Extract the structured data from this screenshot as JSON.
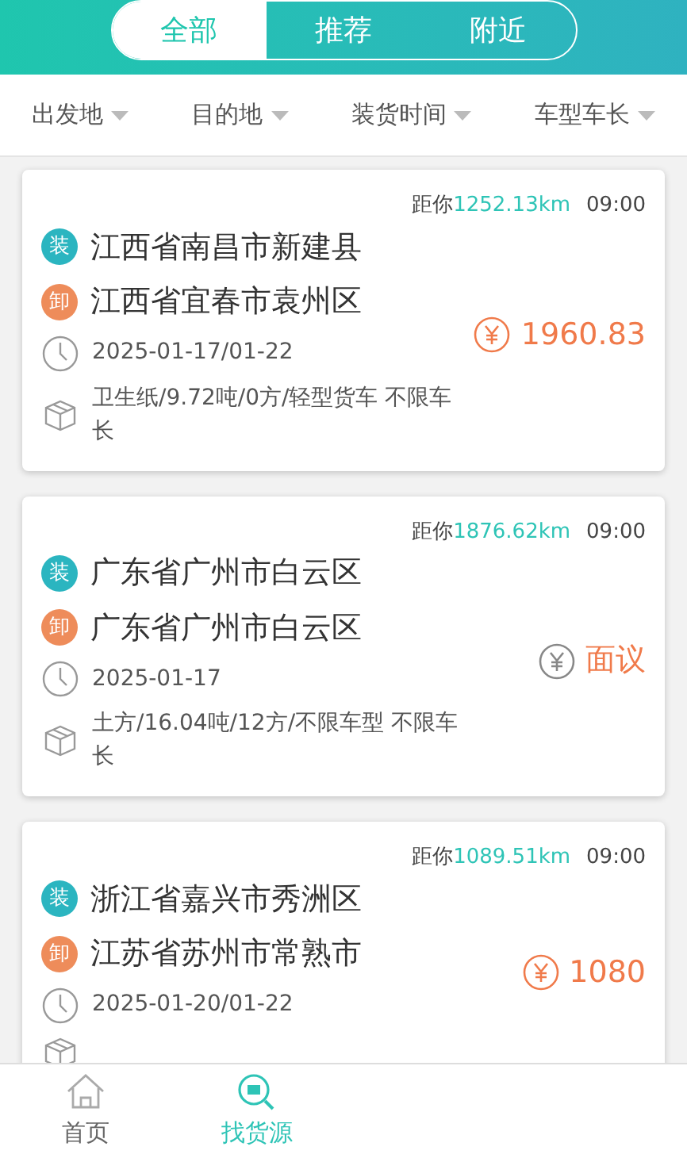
{
  "tabs": [
    {
      "label": "全部",
      "selected": true
    },
    {
      "label": "推荐",
      "selected": false
    },
    {
      "label": "附近",
      "selected": false
    }
  ],
  "filters": [
    "出发地",
    "目的地",
    "装货时间",
    "车型车长"
  ],
  "orders": [
    {
      "distance_prefix": "距你",
      "distance": "1252.13km",
      "time": "09:00",
      "load_badge": "装",
      "load": "江西省南昌市新建县",
      "unload_badge": "卸",
      "unload": "江西省宜春市袁州区",
      "date": "2025-01-17/01-22",
      "cargo": "卫生纸/9.72吨/0方/轻型货车 不限车长",
      "price": {
        "kind": "amount",
        "text": "1960.83"
      }
    },
    {
      "distance_prefix": "距你",
      "distance": "1876.62km",
      "time": "09:00",
      "load_badge": "装",
      "load": "广东省广州市白云区",
      "unload_badge": "卸",
      "unload": "广东省广州市白云区",
      "date": "2025-01-17",
      "cargo": "土方/16.04吨/12方/不限车型 不限车长",
      "price": {
        "kind": "negotiable",
        "text": "面议"
      }
    },
    {
      "distance_prefix": "距你",
      "distance": "1089.51km",
      "time": "09:00",
      "load_badge": "装",
      "load": "浙江省嘉兴市秀洲区",
      "unload_badge": "卸",
      "unload": "江苏省苏州市常熟市",
      "date": "2025-01-20/01-22",
      "price": {
        "kind": "amount",
        "text": "1080"
      }
    }
  ],
  "nav": [
    {
      "label": "首页",
      "kind": "home",
      "selected": false
    },
    {
      "label": "找货源",
      "kind": "search",
      "selected": true
    }
  ]
}
